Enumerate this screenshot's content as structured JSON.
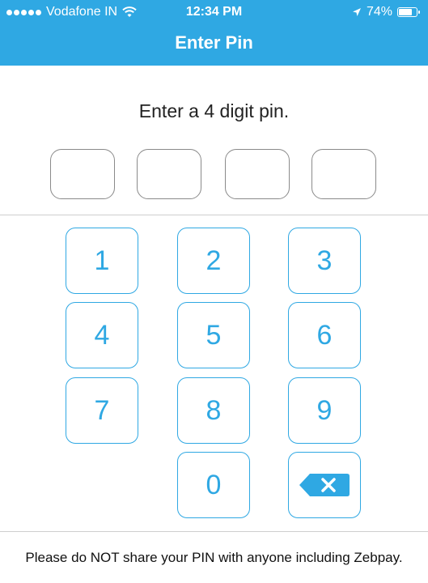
{
  "status_bar": {
    "carrier": "Vodafone IN",
    "time": "12:34 PM",
    "battery": "74%",
    "battery_level": 0.74,
    "signal_icon": "signal-dots-icon",
    "wifi_icon": "wifi-icon",
    "location_icon": "location-arrow-icon",
    "battery_icon": "battery-icon"
  },
  "header": {
    "title": "Enter Pin",
    "background_color": "#2fa8e3"
  },
  "prompt": "Enter a 4 digit pin.",
  "pin": {
    "length": 4,
    "entered": [
      "",
      "",
      "",
      ""
    ]
  },
  "keypad": {
    "keys": [
      "1",
      "2",
      "3",
      "4",
      "5",
      "6",
      "7",
      "8",
      "9",
      "0"
    ],
    "backspace_icon": "backspace-icon",
    "accent_color": "#2fa8e3"
  },
  "footer": {
    "note": "Please do NOT share your PIN with anyone including Zebpay."
  }
}
